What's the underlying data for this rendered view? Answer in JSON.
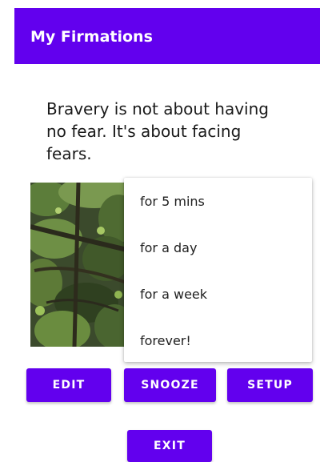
{
  "app_bar": {
    "title": "My Firmations",
    "color": "#6200ee"
  },
  "quote": {
    "text": "Bravery is not about having no fear. It's about facing fears."
  },
  "image": {
    "subject": "forest photo"
  },
  "snooze_menu": {
    "items": [
      {
        "label": "for 5 mins"
      },
      {
        "label": "for a day"
      },
      {
        "label": "for a week"
      },
      {
        "label": "forever!"
      }
    ]
  },
  "buttons": {
    "edit_label": "EDIT",
    "snooze_label": "SNOOZE",
    "setup_label": "SETUP",
    "exit_label": "EXIT"
  }
}
